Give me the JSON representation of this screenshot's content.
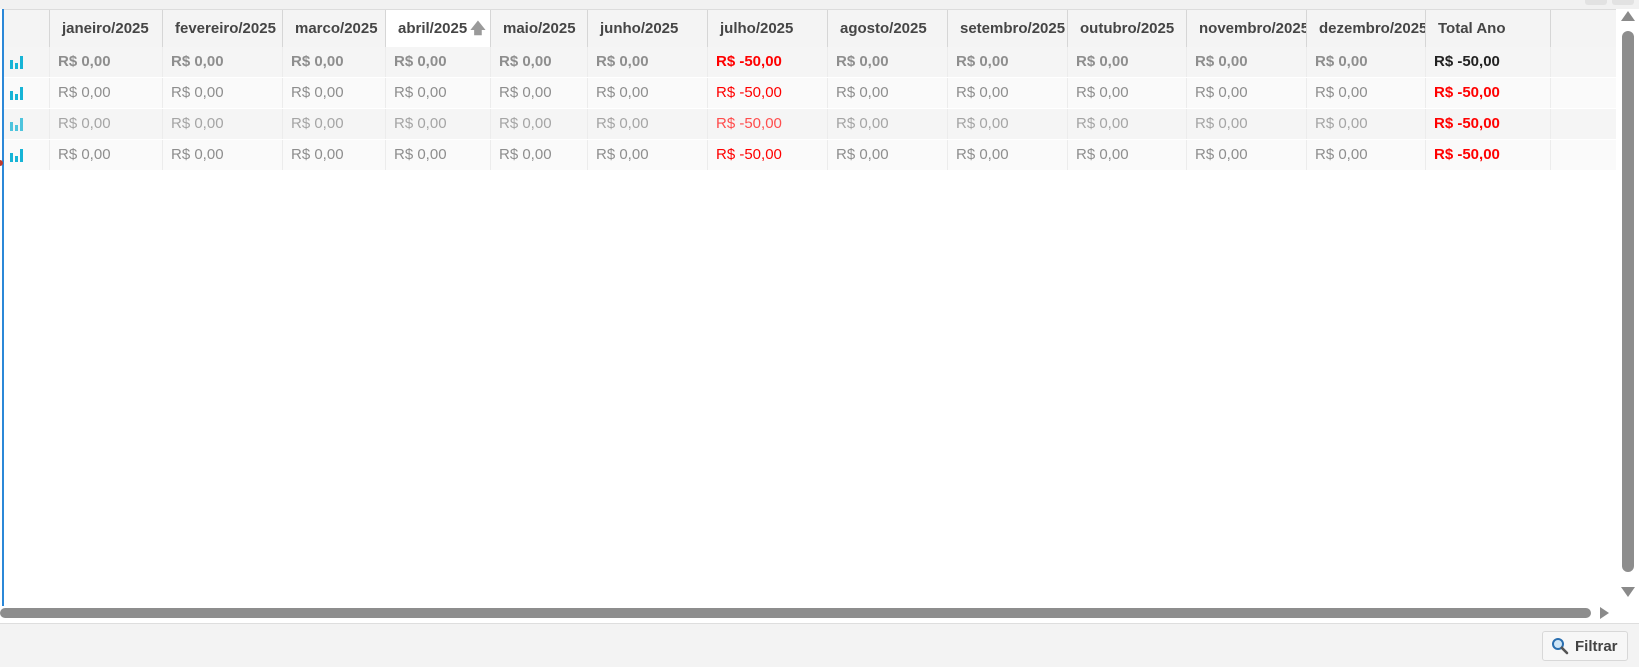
{
  "header": {
    "columns": [
      "",
      "janeiro/2025",
      "fevereiro/2025",
      "marco/2025",
      "abril/2025",
      "maio/2025",
      "junho/2025",
      "julho/2025",
      "agosto/2025",
      "setembro/2025",
      "outubro/2025",
      "novembro/2025",
      "dezembro/2025",
      "Total Ano"
    ],
    "sorted_column": "abril/2025",
    "sort_icon": "sort-ascending-arrow-icon"
  },
  "rows": [
    {
      "icon": "bar-chart-icon",
      "values": [
        "R$ 0,00",
        "R$ 0,00",
        "R$ 0,00",
        "R$ 0,00",
        "R$ 0,00",
        "R$ 0,00",
        "R$ -50,00",
        "R$ 0,00",
        "R$ 0,00",
        "R$ 0,00",
        "R$ 0,00",
        "R$ 0,00"
      ],
      "total": "R$ -50,00"
    },
    {
      "icon": "bar-chart-icon",
      "values": [
        "R$ 0,00",
        "R$ 0,00",
        "R$ 0,00",
        "R$ 0,00",
        "R$ 0,00",
        "R$ 0,00",
        "R$ -50,00",
        "R$ 0,00",
        "R$ 0,00",
        "R$ 0,00",
        "R$ 0,00",
        "R$ 0,00"
      ],
      "total": "R$ -50,00"
    },
    {
      "icon": "bar-chart-icon",
      "values": [
        "R$ 0,00",
        "R$ 0,00",
        "R$ 0,00",
        "R$ 0,00",
        "R$ 0,00",
        "R$ 0,00",
        "R$ -50,00",
        "R$ 0,00",
        "R$ 0,00",
        "R$ 0,00",
        "R$ 0,00",
        "R$ 0,00"
      ],
      "total": "R$ -50,00"
    },
    {
      "icon": "bar-chart-icon",
      "values": [
        "R$ 0,00",
        "R$ 0,00",
        "R$ 0,00",
        "R$ 0,00",
        "R$ 0,00",
        "R$ 0,00",
        "R$ -50,00",
        "R$ 0,00",
        "R$ 0,00",
        "R$ 0,00",
        "R$ 0,00",
        "R$ 0,00"
      ],
      "total": "R$ -50,00"
    }
  ],
  "colors": {
    "negative": "#ff0000",
    "zero": "#8e8e8e",
    "icon_accent": "#17b4d6",
    "selection_border": "#2b88d8"
  },
  "footer": {
    "filter_label": "Filtrar",
    "filter_icon": "search-icon"
  }
}
